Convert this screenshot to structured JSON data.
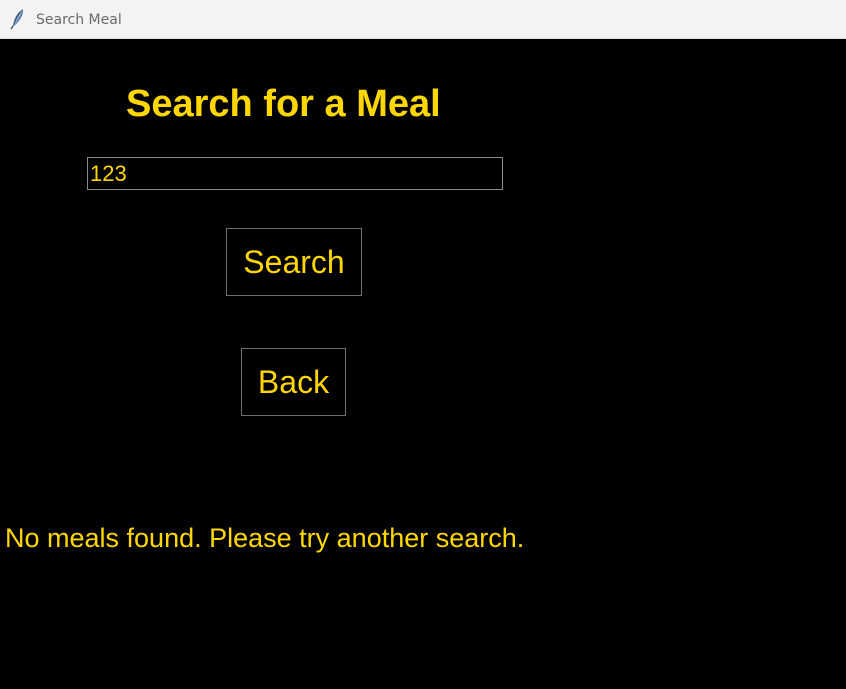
{
  "window": {
    "title": "Search Meal",
    "icon": "feather-icon"
  },
  "main": {
    "heading": "Search for a Meal",
    "search_input": {
      "value": "123",
      "placeholder": ""
    },
    "search_button_label": "Search",
    "back_button_label": "Back",
    "status_message": "No meals found. Please try another search."
  },
  "colors": {
    "background": "#000000",
    "accent_text": "#ffd700",
    "titlebar": "#f3f3f3"
  }
}
